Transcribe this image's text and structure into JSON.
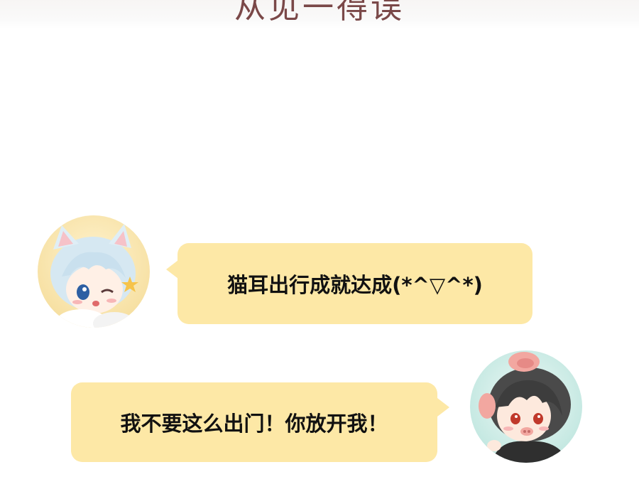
{
  "header": {
    "title": "从见一得误"
  },
  "messages": [
    {
      "side": "left",
      "avatar": "cat-ear-boy-avatar-icon",
      "text": "猫耳出行成就达成(*^▽^*)"
    },
    {
      "side": "right",
      "avatar": "pig-ear-boy-avatar-icon",
      "text": "我不要这么出门！你放开我！"
    }
  ],
  "colors": {
    "bubble": "#fde8a6",
    "header_text": "#7a4848",
    "background": "#ffffff"
  }
}
